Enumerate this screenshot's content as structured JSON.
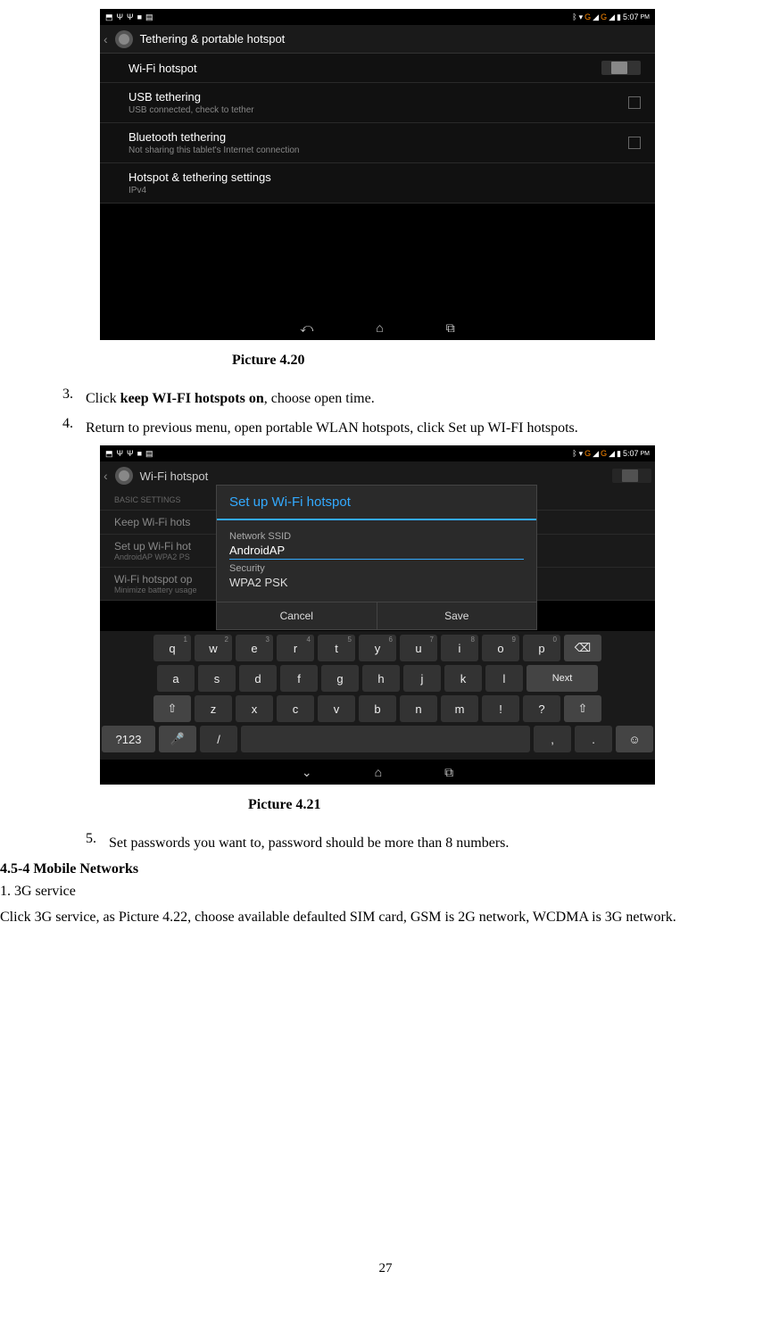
{
  "screenshot1": {
    "statusbar": {
      "time": "5:07",
      "ampm": "PM",
      "signal_label": "G",
      "signal_label2": "G"
    },
    "header": {
      "title": "Tethering & portable hotspot"
    },
    "rows": {
      "wifi": {
        "title": "Wi-Fi hotspot"
      },
      "usb": {
        "title": "USB tethering",
        "sub": "USB connected, check to tether"
      },
      "bt": {
        "title": "Bluetooth tethering",
        "sub": "Not sharing this tablet's Internet connection"
      },
      "more": {
        "title": "Hotspot & tethering settings",
        "sub": "IPv4"
      }
    }
  },
  "caption1": "Picture 4.20",
  "steps_a": {
    "s3_num": "3.",
    "s3_pre": "Click ",
    "s3_bold": "keep WI-FI hotspots on",
    "s3_post": ", choose open time.",
    "s4_num": "4.",
    "s4_text": "Return to previous menu, open portable WLAN hotspots, click Set up WI-FI hotspots."
  },
  "screenshot2": {
    "statusbar": {
      "time": "5:07",
      "ampm": "PM",
      "signal_label": "G",
      "signal_label2": "G"
    },
    "bg": {
      "title": "Wi-Fi hotspot",
      "basic": "BASIC SETTINGS",
      "keep": "Keep Wi-Fi hots",
      "setup": "Set up Wi-Fi hot",
      "setup_sub": "AndroidAP WPA2 PS",
      "opt": "Wi-Fi hotspot op",
      "opt_sub": "Minimize battery usage"
    },
    "dialog": {
      "title": "Set up Wi-Fi hotspot",
      "ssid_label": "Network SSID",
      "ssid_value": "AndroidAP",
      "sec_label": "Security",
      "sec_value": "WPA2 PSK",
      "cancel": "Cancel",
      "save": "Save"
    },
    "keyboard": {
      "r1": [
        "q",
        "w",
        "e",
        "r",
        "t",
        "y",
        "u",
        "i",
        "o",
        "p"
      ],
      "r1n": [
        "1",
        "2",
        "3",
        "4",
        "5",
        "6",
        "7",
        "8",
        "9",
        "0"
      ],
      "r2": [
        "a",
        "s",
        "d",
        "f",
        "g",
        "h",
        "j",
        "k",
        "l"
      ],
      "r3": [
        "z",
        "x",
        "c",
        "v",
        "b",
        "n",
        "m",
        "!",
        "?"
      ],
      "next": "Next",
      "sym": "?123",
      "comma": ",",
      "period": ".",
      "slash": "/"
    }
  },
  "caption2": "Picture 4.21",
  "steps_b": {
    "s5_num": "5.",
    "s5_text": "Set passwords you want to, password should be more than 8 numbers."
  },
  "section": {
    "heading": "4.5-4 Mobile Networks",
    "l1": "1. 3G service",
    "l2": "Click 3G service, as Picture 4.22, choose available defaulted SIM card, GSM is 2G network, WCDMA is 3G network."
  },
  "pagenum": "27"
}
